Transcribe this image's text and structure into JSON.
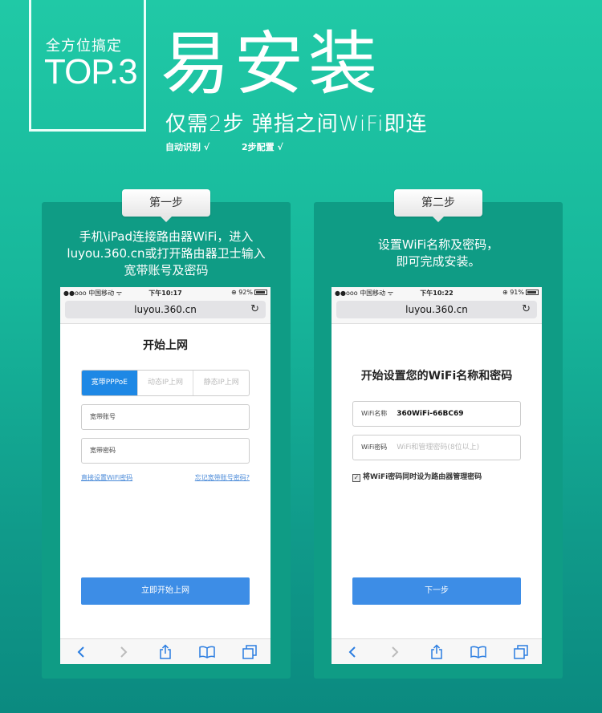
{
  "header": {
    "badge_line1": "全方位搞定",
    "badge_line2": "TOP.3",
    "title": "易安装",
    "subtitle": "仅需2步 弹指之间WiFi即连",
    "tag1": "自动识别 √",
    "tag2": "2步配置 √"
  },
  "step1": {
    "label": "第一步",
    "desc_line1": "手机\\iPad连接路由器WiFi，进入",
    "desc_line2": "luyou.360.cn或打开路由器卫士输入",
    "desc_line3": "宽带账号及密码",
    "phone": {
      "carrier": "●●ooo 中国移动 ᯤ",
      "time": "下午10:17",
      "battery": "⊕ 92%",
      "url": "luyou.360.cn",
      "screen_title": "开始上网",
      "tabs": [
        "宽带PPPoE",
        "动态IP上网",
        "静态IP上网"
      ],
      "field_account": "宽带账号",
      "field_password": "宽带密码",
      "link_left": "直接设置WiFi密码",
      "link_right": "忘记宽带账号密码?",
      "button": "立即开始上网"
    }
  },
  "step2": {
    "label": "第二步",
    "desc_line1": "设置WiFi名称及密码，",
    "desc_line2": "即可完成安装。",
    "phone": {
      "carrier": "●●ooo 中国移动 ᯤ",
      "time": "下午10:22",
      "battery": "⊕ 91%",
      "url": "luyou.360.cn",
      "screen_title": "开始设置您的WiFi名称和密码",
      "field_name_label": "WiFi名称",
      "field_name_value": "360WiFi-66BC69",
      "field_pwd_label": "WiFi密码",
      "field_pwd_placeholder": "WiFi和管理密码(8位以上)",
      "checkbox_label": "将WiFi密码同时设为路由器管理密码",
      "button": "下一步"
    }
  },
  "colors": {
    "bg_top": "#20c9a6",
    "bg_bottom": "#0b8a80",
    "panel": "#0f9c85",
    "primary_button": "#3d8de6",
    "active_tab": "#1e88e5",
    "link": "#4a8ad8"
  },
  "icons": [
    "back-icon",
    "forward-icon",
    "share-icon",
    "bookmarks-icon",
    "tabs-icon",
    "reload-icon",
    "wifi-icon",
    "battery-icon",
    "checkbox-icon"
  ]
}
